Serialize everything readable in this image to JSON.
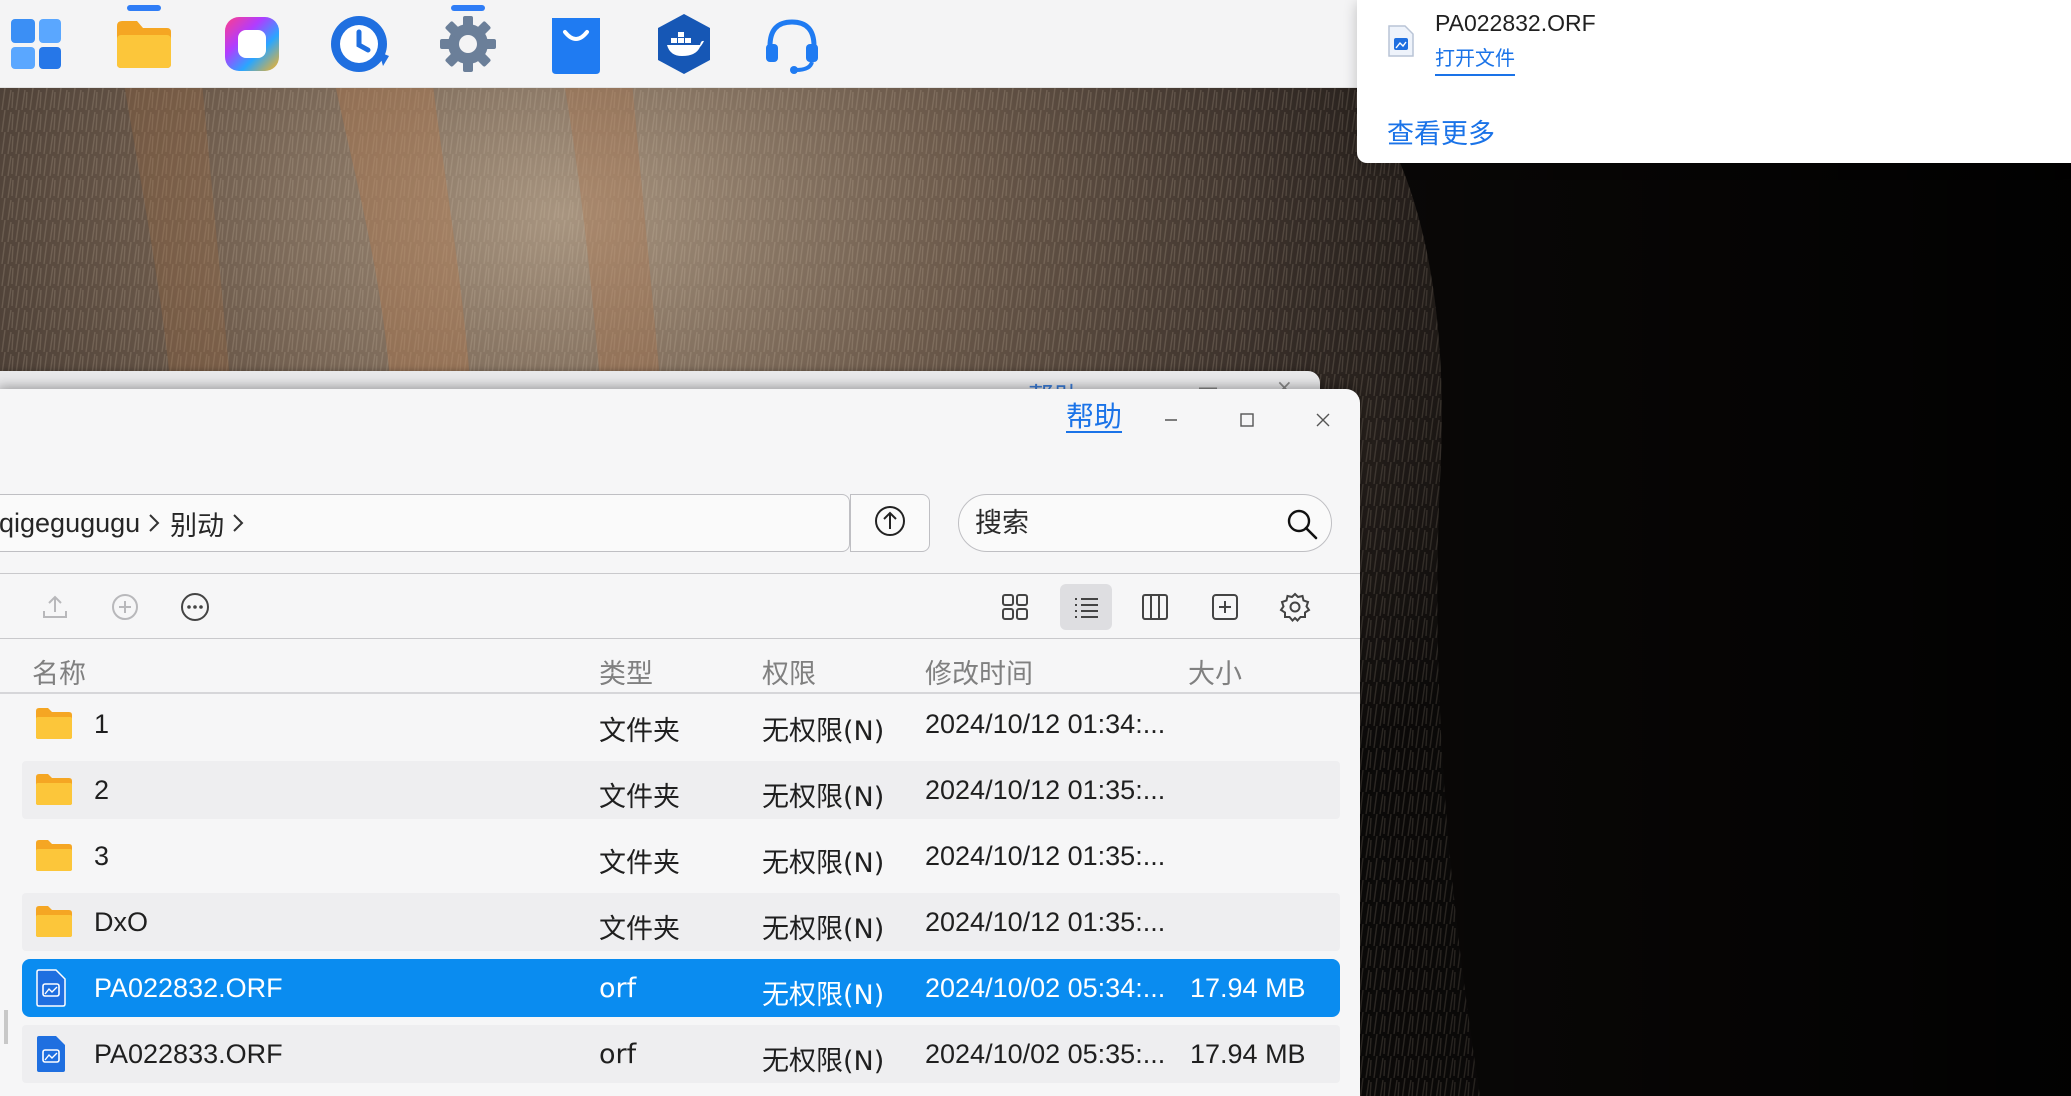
{
  "dock": {
    "items": [
      {
        "icon": "launcher-grid-icon",
        "running": false
      },
      {
        "icon": "file-manager-folder-icon",
        "running": true
      },
      {
        "icon": "photos-app-icon",
        "running": false
      },
      {
        "icon": "backup-clock-icon",
        "running": false
      },
      {
        "icon": "settings-gear-icon",
        "running": true
      },
      {
        "icon": "app-store-bag-icon",
        "running": false
      },
      {
        "icon": "docker-icon",
        "running": false
      },
      {
        "icon": "support-headset-icon",
        "running": false
      }
    ]
  },
  "notification": {
    "file_name": "PA022832.ORF",
    "open_link": "打开文件",
    "more_link": "查看更多"
  },
  "back_window": {
    "help_label": "帮助"
  },
  "window": {
    "help_label": "帮助",
    "controls": [
      "minimize-icon",
      "maximize-icon",
      "close-icon"
    ],
    "path": [
      "qigegugugu",
      "别动"
    ],
    "search_placeholder": "搜索",
    "toolbar": {
      "left": [
        "upload-icon",
        "new-icon",
        "more-icon"
      ],
      "right": [
        "grid-view-icon",
        "list-view-icon",
        "column-view-icon",
        "add-panel-icon",
        "view-settings-icon"
      ],
      "active_view": "list-view-icon"
    },
    "columns": {
      "name": "名称",
      "type": "类型",
      "permission": "权限",
      "modified": "修改时间",
      "size": "大小"
    },
    "files": [
      {
        "name": "1",
        "type": "文件夹",
        "permission": "无权限(N)",
        "modified": "2024/10/12 01:34:...",
        "size": "",
        "kind": "folder",
        "selected": false
      },
      {
        "name": "2",
        "type": "文件夹",
        "permission": "无权限(N)",
        "modified": "2024/10/12 01:35:...",
        "size": "",
        "kind": "folder",
        "selected": false
      },
      {
        "name": "3",
        "type": "文件夹",
        "permission": "无权限(N)",
        "modified": "2024/10/12 01:35:...",
        "size": "",
        "kind": "folder",
        "selected": false
      },
      {
        "name": "DxO",
        "type": "文件夹",
        "permission": "无权限(N)",
        "modified": "2024/10/12 01:35:...",
        "size": "",
        "kind": "folder",
        "selected": false
      },
      {
        "name": "PA022832.ORF",
        "type": "orf",
        "permission": "无权限(N)",
        "modified": "2024/10/02 05:34:...",
        "size": "17.94 MB",
        "kind": "image",
        "selected": true
      },
      {
        "name": "PA022833.ORF",
        "type": "orf",
        "permission": "无权限(N)",
        "modified": "2024/10/02 05:35:...",
        "size": "17.94 MB",
        "kind": "image",
        "selected": false
      }
    ]
  },
  "colors": {
    "accent": "#1a73e8",
    "selection": "#0a8cf0",
    "folder": "#f9b81a",
    "file_icon": "#1f6fe0"
  }
}
